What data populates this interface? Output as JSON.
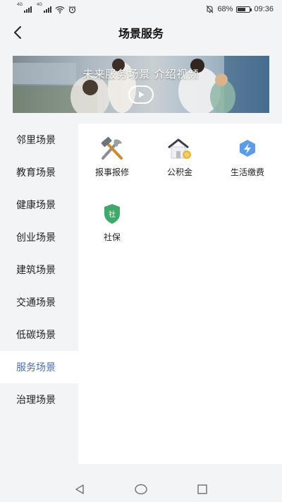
{
  "status_bar": {
    "sim1": "4G",
    "sim2": "4G",
    "battery": "68%",
    "battery_level": 0.68,
    "time": "09:36"
  },
  "header": {
    "title": "场景服务"
  },
  "banner": {
    "text": "未来服务场景 介绍视频"
  },
  "sidebar": {
    "items": [
      {
        "label": "邻里场景"
      },
      {
        "label": "教育场景"
      },
      {
        "label": "健康场景"
      },
      {
        "label": "创业场景"
      },
      {
        "label": "建筑场景"
      },
      {
        "label": "交通场景"
      },
      {
        "label": "低碳场景"
      },
      {
        "label": "服务场景"
      },
      {
        "label": "治理场景"
      }
    ],
    "active_label": "服务场景"
  },
  "services": [
    {
      "label": "报事报修",
      "icon": "tools-icon"
    },
    {
      "label": "公积金",
      "icon": "house-coin-icon"
    },
    {
      "label": "生活缴费",
      "icon": "lightning-icon"
    },
    {
      "label": "社保",
      "icon": "social-security-shield-icon",
      "icon_text": "社"
    }
  ],
  "colors": {
    "active": "#4a6fa5",
    "background": "#f3f4f6",
    "panel": "#ffffff",
    "accent_blue": "#5b9be8",
    "accent_green": "#3fa86a"
  }
}
